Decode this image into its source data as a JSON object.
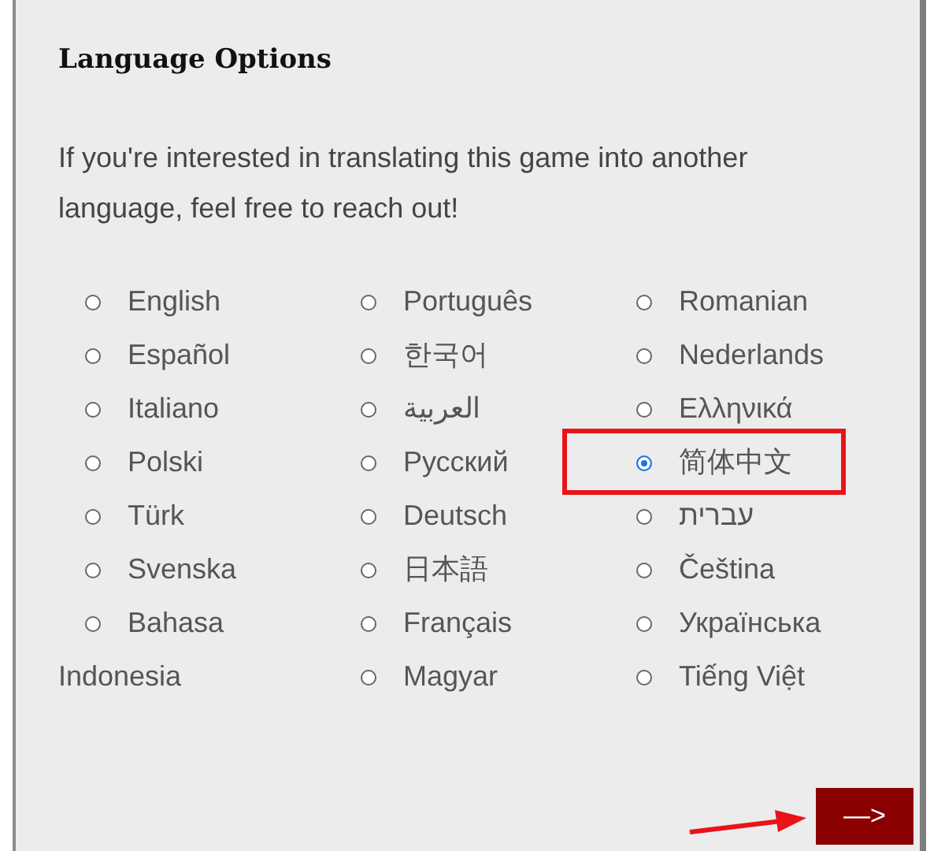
{
  "title": "Language Options",
  "intro": "If you're interested in translating this game into another language, feel free to reach out!",
  "columns": [
    [
      {
        "label": "English",
        "selected": false
      },
      {
        "label": "Español",
        "selected": false
      },
      {
        "label": "Italiano",
        "selected": false
      },
      {
        "label": "Polski",
        "selected": false
      },
      {
        "label": "Türk",
        "selected": false
      },
      {
        "label": "Svenska",
        "selected": false
      },
      {
        "label": "Bahasa Indonesia",
        "selected": false
      }
    ],
    [
      {
        "label": "Português",
        "selected": false
      },
      {
        "label": "한국어",
        "selected": false
      },
      {
        "label": "العربية",
        "selected": false
      },
      {
        "label": "Русский",
        "selected": false
      },
      {
        "label": "Deutsch",
        "selected": false
      },
      {
        "label": "日本語",
        "selected": false
      },
      {
        "label": "Français",
        "selected": false
      },
      {
        "label": "Magyar",
        "selected": false
      }
    ],
    [
      {
        "label": "Romanian",
        "selected": false
      },
      {
        "label": "Nederlands",
        "selected": false
      },
      {
        "label": "Ελληνικά",
        "selected": false
      },
      {
        "label": "简体中文",
        "selected": true,
        "highlighted": true
      },
      {
        "label": "עברית",
        "selected": false
      },
      {
        "label": "Čeština",
        "selected": false
      },
      {
        "label": "Українська",
        "selected": false
      },
      {
        "label": "Tiếng Việt",
        "selected": false
      }
    ]
  ],
  "next_button": "—>"
}
